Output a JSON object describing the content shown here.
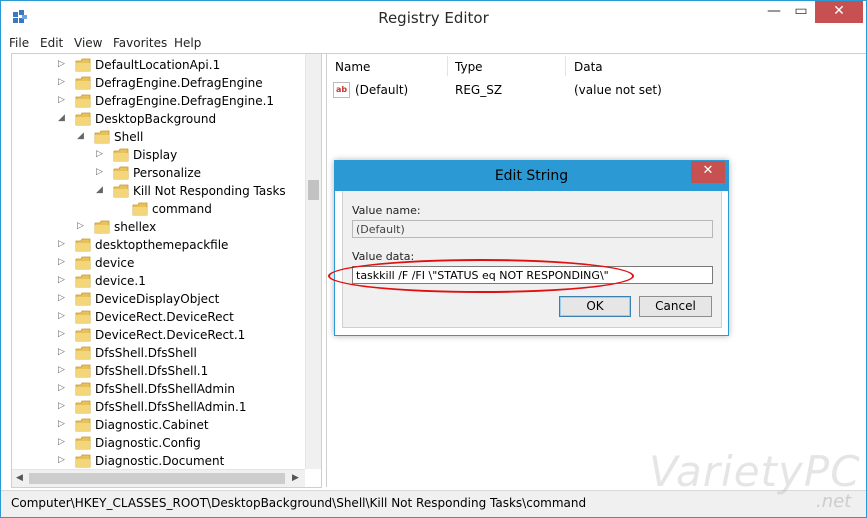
{
  "window": {
    "title": "Registry Editor",
    "controls": {
      "minimize": "—",
      "maximize": "▭",
      "close": "✕"
    }
  },
  "menu": [
    "File",
    "Edit",
    "View",
    "Favorites",
    "Help"
  ],
  "tree": [
    {
      "label": "DefaultLocationApi.1",
      "arrow": "▷",
      "indent": 0
    },
    {
      "label": "DefragEngine.DefragEngine",
      "arrow": "▷",
      "indent": 0
    },
    {
      "label": "DefragEngine.DefragEngine.1",
      "arrow": "▷",
      "indent": 0
    },
    {
      "label": "DesktopBackground",
      "arrow": "◢",
      "indent": 0
    },
    {
      "label": "Shell",
      "arrow": "◢",
      "indent": 1
    },
    {
      "label": "Display",
      "arrow": "▷",
      "indent": 2
    },
    {
      "label": "Personalize",
      "arrow": "▷",
      "indent": 2
    },
    {
      "label": "Kill Not Responding Tasks",
      "arrow": "◢",
      "indent": 2
    },
    {
      "label": "command",
      "arrow": "",
      "indent": 3
    },
    {
      "label": "shellex",
      "arrow": "▷",
      "indent": 1
    },
    {
      "label": "desktopthemepackfile",
      "arrow": "▷",
      "indent": 0
    },
    {
      "label": "device",
      "arrow": "▷",
      "indent": 0
    },
    {
      "label": "device.1",
      "arrow": "▷",
      "indent": 0
    },
    {
      "label": "DeviceDisplayObject",
      "arrow": "▷",
      "indent": 0
    },
    {
      "label": "DeviceRect.DeviceRect",
      "arrow": "▷",
      "indent": 0
    },
    {
      "label": "DeviceRect.DeviceRect.1",
      "arrow": "▷",
      "indent": 0
    },
    {
      "label": "DfsShell.DfsShell",
      "arrow": "▷",
      "indent": 0
    },
    {
      "label": "DfsShell.DfsShell.1",
      "arrow": "▷",
      "indent": 0
    },
    {
      "label": "DfsShell.DfsShellAdmin",
      "arrow": "▷",
      "indent": 0
    },
    {
      "label": "DfsShell.DfsShellAdmin.1",
      "arrow": "▷",
      "indent": 0
    },
    {
      "label": "Diagnostic.Cabinet",
      "arrow": "▷",
      "indent": 0
    },
    {
      "label": "Diagnostic.Config",
      "arrow": "▷",
      "indent": 0
    },
    {
      "label": "Diagnostic.Document",
      "arrow": "▷",
      "indent": 0
    }
  ],
  "list": {
    "columns": [
      "Name",
      "Type",
      "Data"
    ],
    "rows": [
      {
        "name": "(Default)",
        "type": "REG_SZ",
        "data": "(value not set)",
        "icon": "ab"
      }
    ]
  },
  "status_path": "Computer\\HKEY_CLASSES_ROOT\\DesktopBackground\\Shell\\Kill Not Responding Tasks\\command",
  "dialog": {
    "title": "Edit String",
    "close": "✕",
    "value_name_label": "Value name:",
    "value_name": "(Default)",
    "value_data_label": "Value data:",
    "value_data": "taskkill /F /FI \\\"STATUS eq NOT RESPONDING\\\"",
    "ok": "OK",
    "cancel": "Cancel"
  },
  "watermark": {
    "brand": "VarietyPC",
    "suffix": ".net"
  },
  "colors": {
    "accent": "#2b9ad4",
    "close": "#c75050",
    "highlight_ellipse": "#e01010",
    "folder": "#e8c15a"
  }
}
